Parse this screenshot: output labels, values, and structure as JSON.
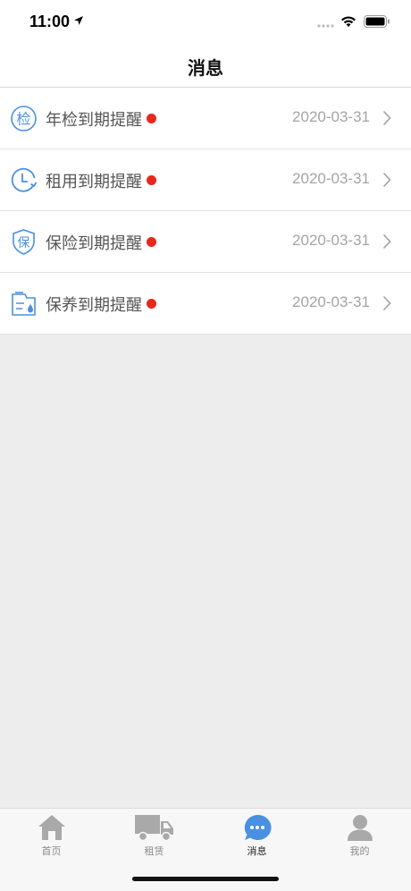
{
  "status_bar": {
    "time": "11:00"
  },
  "nav": {
    "title": "消息"
  },
  "messages": [
    {
      "icon": "inspection-icon",
      "icon_text": "检",
      "title": "年检到期提醒",
      "date": "2020-03-31",
      "unread": true
    },
    {
      "icon": "clock-icon",
      "title": "租用到期提醒",
      "date": "2020-03-31",
      "unread": true
    },
    {
      "icon": "insurance-shield-icon",
      "icon_text": "保",
      "title": "保险到期提醒",
      "date": "2020-03-31",
      "unread": true
    },
    {
      "icon": "maintenance-icon",
      "title": "保养到期提醒",
      "date": "2020-03-31",
      "unread": true
    }
  ],
  "tabs": [
    {
      "label": "首页",
      "icon": "home-icon",
      "active": false
    },
    {
      "label": "租赁",
      "icon": "truck-icon",
      "active": false
    },
    {
      "label": "消息",
      "icon": "chat-bubble-icon",
      "active": true
    },
    {
      "label": "我的",
      "icon": "person-icon",
      "active": false
    }
  ],
  "colors": {
    "accent": "#4a90e2",
    "unread_dot": "#e8271b",
    "inactive_icon": "#a9a9a9",
    "background": "#ededed"
  }
}
